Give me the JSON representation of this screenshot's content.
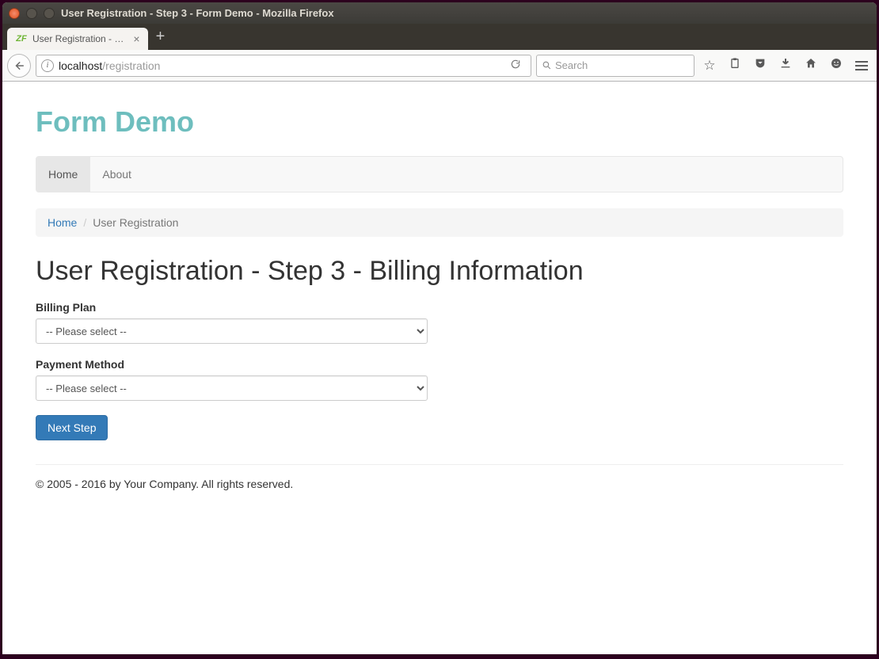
{
  "window": {
    "title": "User Registration - Step 3 - Form Demo - Mozilla Firefox"
  },
  "tab": {
    "title": "User Registration - …"
  },
  "url": {
    "host": "localhost",
    "path": "/registration"
  },
  "search": {
    "placeholder": "Search"
  },
  "brand": "Form Demo",
  "nav": {
    "home": "Home",
    "about": "About"
  },
  "breadcrumb": {
    "home": "Home",
    "current": "User Registration"
  },
  "heading": "User Registration - Step 3 - Billing Information",
  "form": {
    "billing_plan": {
      "label": "Billing Plan",
      "selected": "-- Please select --"
    },
    "payment_method": {
      "label": "Payment Method",
      "selected": "-- Please select --"
    },
    "submit_label": "Next Step"
  },
  "footer": "© 2005 - 2016 by Your Company. All rights reserved."
}
